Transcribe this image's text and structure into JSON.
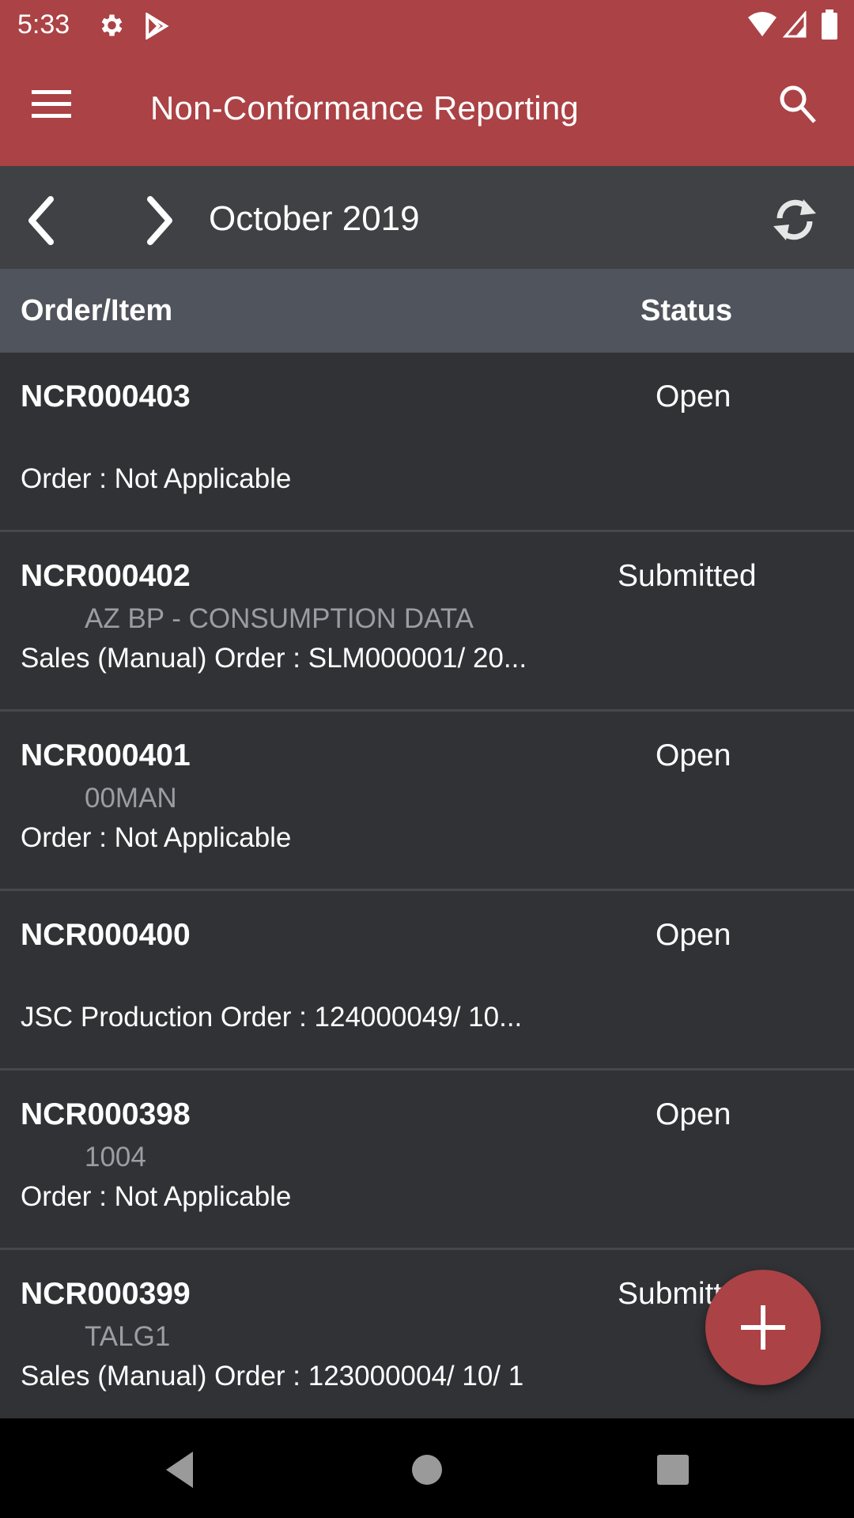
{
  "status_bar": {
    "time": "5:33",
    "icons": [
      "settings-icon",
      "play-store-icon",
      "wifi-icon",
      "signal-icon",
      "battery-icon"
    ]
  },
  "toolbar": {
    "title": "Non-Conformance Reporting",
    "menu_icon": "hamburger-menu-icon",
    "search_icon": "search-icon"
  },
  "period_nav": {
    "month": "October 2019",
    "prev_icon": "chevron-left-icon",
    "next_icon": "chevron-right-icon",
    "refresh_icon": "refresh-icon"
  },
  "table": {
    "headers": {
      "order_item": "Order/Item",
      "status": "Status"
    },
    "rows": [
      {
        "id": "NCR000403",
        "status": "Open",
        "sub": "",
        "order": "Order  :  Not Applicable"
      },
      {
        "id": "NCR000402",
        "status": "Submitted",
        "sub": "AZ BP - CONSUMPTION DATA",
        "order": "Sales (Manual) Order :  SLM000001/ 20..."
      },
      {
        "id": "NCR000401",
        "status": "Open",
        "sub": "00MAN",
        "order": "Order  :  Not Applicable"
      },
      {
        "id": "NCR000400",
        "status": "Open",
        "sub": "",
        "order": "JSC Production Order :  124000049/ 10..."
      },
      {
        "id": "NCR000398",
        "status": "Open",
        "sub": "1004",
        "order": "Order  :  Not Applicable"
      },
      {
        "id": "NCR000399",
        "status": "Submitted",
        "sub": "TALG1",
        "order": "Sales (Manual) Order :  123000004/ 10/ 1"
      }
    ]
  },
  "fab": {
    "icon": "plus-icon",
    "color": "#ab4245"
  },
  "system_nav": {
    "back": "back-icon",
    "home": "home-icon",
    "recents": "recents-icon"
  },
  "colors": {
    "accent": "#ab4245",
    "nav_bar": "#404144",
    "header": "#50545c",
    "row_bg": "#313236",
    "sub_text": "#9b9da2"
  }
}
